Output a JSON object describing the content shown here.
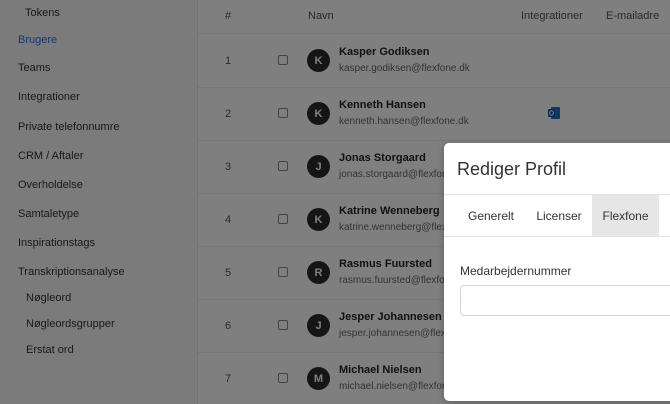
{
  "sidebar": {
    "items": [
      {
        "label": "Tokens",
        "sub": true
      },
      {
        "label": "Brugere",
        "active": true
      },
      {
        "label": "Teams"
      },
      {
        "label": "Integrationer"
      },
      {
        "label": "Private telefonnumre"
      },
      {
        "label": "CRM / Aftaler"
      },
      {
        "label": "Overholdelse"
      },
      {
        "label": "Samtaletype"
      },
      {
        "label": "Inspirationstags"
      },
      {
        "label": "Transkriptionsanalyse"
      },
      {
        "label": "Nøgleord",
        "sub": true
      },
      {
        "label": "Nøgleordsgrupper",
        "sub": true
      },
      {
        "label": "Erstat ord",
        "sub": true
      }
    ]
  },
  "table": {
    "headers": {
      "num": "#",
      "name": "Navn",
      "integrations": "Integrationer",
      "email": "E-mailadre"
    },
    "rows": [
      {
        "num": "1",
        "initial": "K",
        "name": "Kasper Godiksen",
        "email": "kasper.godiksen@flexfone.dk",
        "integration": false
      },
      {
        "num": "2",
        "initial": "K",
        "name": "Kenneth Hansen",
        "email": "kenneth.hansen@flexfone.dk",
        "integration": true
      },
      {
        "num": "3",
        "initial": "J",
        "name": "Jonas Storgaard",
        "email": "jonas.storgaard@flexfone.dk",
        "integration": false
      },
      {
        "num": "4",
        "initial": "K",
        "name": "Katrine Wenneberg",
        "email": "katrine.wenneberg@flexfone.dk",
        "integration": false
      },
      {
        "num": "5",
        "initial": "R",
        "name": "Rasmus Fuursted",
        "email": "rasmus.fuursted@flexfone.dk",
        "integration": false
      },
      {
        "num": "6",
        "initial": "J",
        "name": "Jesper Johannesen",
        "email": "jesper.johannesen@flexfone.dk",
        "integration": false
      },
      {
        "num": "7",
        "initial": "M",
        "name": "Michael Nielsen",
        "email": "michael.nielsen@flexfone.dk",
        "integration": false
      }
    ]
  },
  "modal": {
    "title": "Rediger Profil",
    "tabs": [
      {
        "label": "Generelt"
      },
      {
        "label": "Licenser"
      },
      {
        "label": "Flexfone",
        "active": true
      }
    ],
    "field_label": "Medarbejdernummer",
    "field_value": ""
  },
  "colors": {
    "active_link": "#2d6fe0",
    "integration_icon": "#1a73c9",
    "overlay": "rgba(0,0,0,0.5)"
  }
}
